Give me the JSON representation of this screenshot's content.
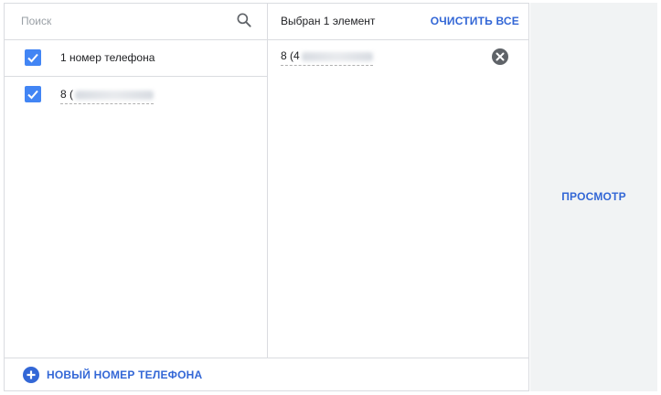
{
  "search": {
    "placeholder": "Поиск",
    "value": "",
    "icon": "search-icon"
  },
  "list": {
    "items": [
      {
        "label": "1 номер телефона",
        "checked": true
      },
      {
        "label": "8 (",
        "checked": true,
        "redacted": true
      }
    ]
  },
  "selection": {
    "count_text": "Выбран 1 элемент",
    "clear_all_label": "ОЧИСТИТЬ ВСЕ",
    "items": [
      {
        "label": "8 (4",
        "redacted": true,
        "remove_icon": "close-circle-icon"
      }
    ]
  },
  "footer": {
    "add_label": "НОВЫЙ НОМЕР ТЕЛЕФОНА",
    "add_icon": "add-circle-icon"
  },
  "preview": {
    "label": "ПРОСМОТР"
  },
  "colors": {
    "accent": "#3367d6",
    "checkbox": "#4285f4",
    "border": "#dadce0",
    "panel_bg": "#f1f3f4"
  }
}
